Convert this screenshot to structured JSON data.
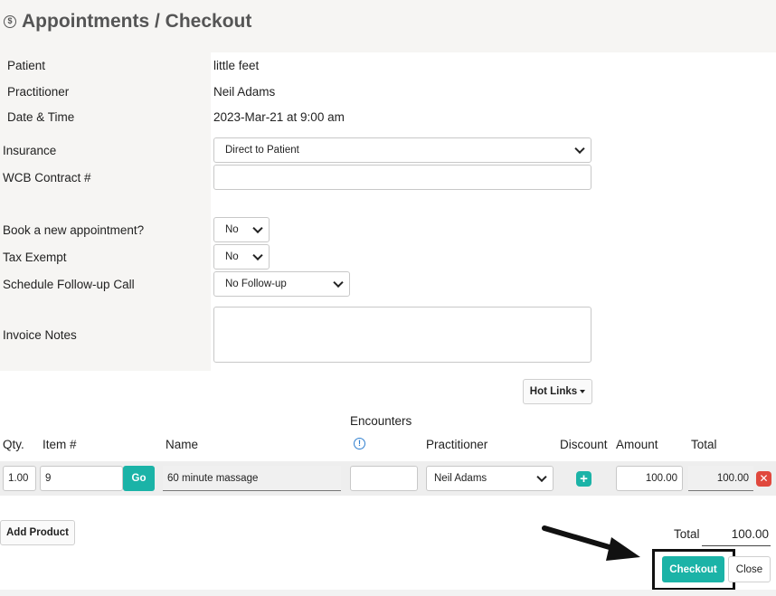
{
  "page": {
    "title": "Appointments / Checkout",
    "title_icon": "dollar-circle-icon"
  },
  "details": {
    "patient_label": "Patient",
    "patient_value": "little feet",
    "practitioner_label": "Practitioner",
    "practitioner_value": "Neil Adams",
    "datetime_label": "Date & Time",
    "datetime_value": "2023-Mar-21 at 9:00 am"
  },
  "form": {
    "insurance_label": "Insurance",
    "insurance_value": "Direct to Patient",
    "wcb_label": "WCB Contract #",
    "wcb_value": "",
    "book_label": "Book a new appointment?",
    "book_value": "No",
    "tax_label": "Tax Exempt",
    "tax_value": "No",
    "followup_label": "Schedule Follow-up Call",
    "followup_value": "No Follow-up",
    "notes_label": "Invoice Notes",
    "notes_value": ""
  },
  "toolbar": {
    "hot_links_label": "Hot Links"
  },
  "table": {
    "headers": {
      "qty": "Qty.",
      "item": "Item #",
      "name": "Name",
      "encounters": "Encounters",
      "practitioner": "Practitioner",
      "discount": "Discount",
      "amount": "Amount",
      "total": "Total"
    },
    "rows": [
      {
        "qty": "1.00",
        "item": "9",
        "go_label": "Go",
        "name": "60 minute massage",
        "encounters": "",
        "practitioner": "Neil Adams",
        "amount": "100.00",
        "total": "100.00"
      }
    ]
  },
  "footer": {
    "add_product_label": "Add Product",
    "total_label": "Total",
    "total_value": "100.00",
    "checkout_label": "Checkout",
    "close_label": "Close"
  },
  "colors": {
    "accent": "#1bb3a7",
    "danger": "#e0483d",
    "info": "#2f7fd0"
  }
}
